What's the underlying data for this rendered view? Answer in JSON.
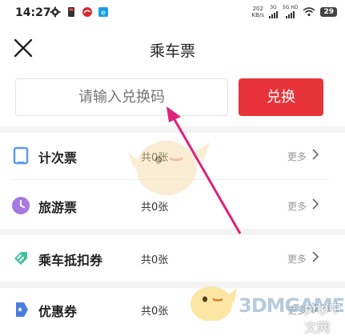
{
  "status_bar": {
    "time": "14:27",
    "net_speed_value": "202",
    "net_speed_unit": "KB/s",
    "sim1_label": "3G",
    "sim2_label": "5G HD",
    "battery": "29"
  },
  "header": {
    "title": "乘车票"
  },
  "redeem": {
    "placeholder": "请输入兑换码",
    "button_label": "兑换",
    "accent_color": "#e8333a"
  },
  "tickets": [
    {
      "title": "计次票",
      "count": "共0张",
      "more": "更多",
      "icon": "card-icon",
      "color": "#5b9bf0"
    },
    {
      "title": "旅游票",
      "count": "共0张",
      "more": "更多",
      "icon": "clock-icon",
      "color": "#a879e0"
    },
    {
      "title": "乘车抵扣券",
      "count": "共0张",
      "more": "更多",
      "icon": "discount-tag-icon",
      "color": "#3dc29b"
    },
    {
      "title": "优惠券",
      "count": "共0张",
      "more": "更多",
      "icon": "coupon-icon",
      "color": "#4a7fe0"
    }
  ],
  "watermark": {
    "brand": "3DMGAME",
    "site": "php中文网"
  }
}
